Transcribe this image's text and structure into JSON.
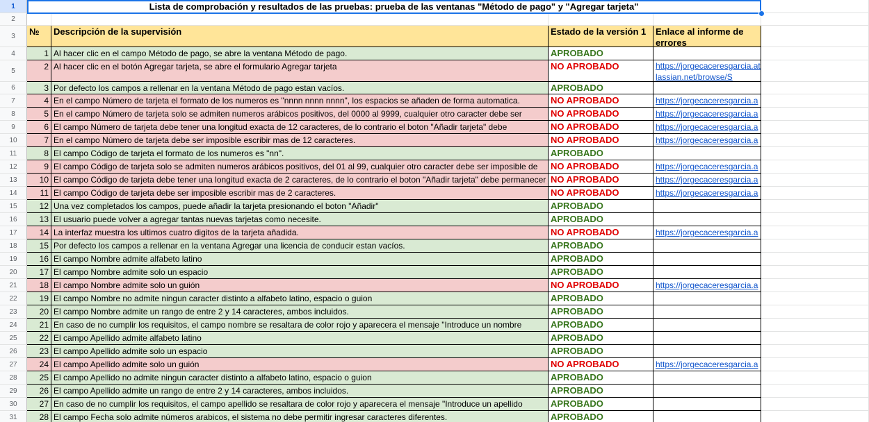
{
  "sheet": {
    "title": "Lista de comprobación y resultados de las pruebas: prueba de las ventanas \"Método de pago\" y \"Agregar tarjeta\"",
    "headers": {
      "num": "№",
      "description": "Descripción de la supervisión",
      "status": "Estado de la versión 1",
      "link": "Enlace al informe de errores"
    },
    "row_numbers": [
      "1",
      "2",
      "3",
      "4",
      "5",
      "6",
      "7",
      "8",
      "9",
      "10",
      "11",
      "12",
      "13",
      "14",
      "15",
      "16",
      "17",
      "18",
      "19",
      "20",
      "21",
      "22",
      "23",
      "24",
      "25",
      "26",
      "27",
      "28",
      "29",
      "30",
      "31"
    ],
    "status_labels": {
      "pass": "APROBADO",
      "fail": "NO APROBADO"
    },
    "colors": {
      "pass_bg": "#d9ead3",
      "fail_bg": "#f4cccc",
      "header_bg": "#ffe599",
      "pass_text": "#38761d",
      "fail_text": "#e00000",
      "link": "#1155cc"
    },
    "rows": [
      {
        "n": "1",
        "desc": "Al hacer clic en el campo Método de pago, se abre la ventana Método de pago.",
        "status": "APROBADO",
        "result": "pass",
        "link": ""
      },
      {
        "n": "2",
        "desc": "Al hacer clic en el botón Agregar tarjeta, se abre el formulario Agregar tarjeta",
        "status": "NO APROBADO",
        "result": "fail",
        "link": "https://jorgecaceresgarcia.atlassian.net/browse/S"
      },
      {
        "n": "3",
        "desc": "Por defecto los campos a rellenar en la ventana Método de pago estan vacíos.",
        "status": "APROBADO",
        "result": "pass",
        "link": ""
      },
      {
        "n": "4",
        "desc": "En el campo Número de tarjeta el formato de los numeros es \"nnnn nnnn nnnn\", los espacios se añaden de forma automatica.",
        "status": "NO APROBADO",
        "result": "fail",
        "link": "https://jorgecaceresgarcia.a"
      },
      {
        "n": "5",
        "desc": "En el campo Número de tarjeta solo se admiten numeros arábicos positivos, del 0000 al 9999, cualquier otro caracter debe ser",
        "status": "NO APROBADO",
        "result": "fail",
        "link": "https://jorgecaceresgarcia.a"
      },
      {
        "n": "6",
        "desc": "El campo Número de tarjeta debe tener una longitud exacta de 12 caracteres, de lo contrario el boton \"Añadir tarjeta\" debe",
        "status": "NO APROBADO",
        "result": "fail",
        "link": "https://jorgecaceresgarcia.a"
      },
      {
        "n": "7",
        "desc": "En el campo Número de tarjeta debe ser imposible escribir mas de 12 caracteres.",
        "status": "NO APROBADO",
        "result": "fail",
        "link": "https://jorgecaceresgarcia.a"
      },
      {
        "n": "8",
        "desc": "El campo Código de tarjeta el formato de los numeros es \"nn\".",
        "status": "APROBADO",
        "result": "pass",
        "link": ""
      },
      {
        "n": "9",
        "desc": "El campo Código de tarjeta solo se admiten numeros arábicos positivos, del 01 al 99, cualquier otro caracter debe ser imposible de",
        "status": "NO APROBADO",
        "result": "fail",
        "link": "https://jorgecaceresgarcia.a"
      },
      {
        "n": "10",
        "desc": "El campo Código de tarjeta debe tener una longitud exacta de 2 caracteres, de lo contrario el boton \"Añadir tarjeta\" debe permanecer",
        "status": "NO APROBADO",
        "result": "fail",
        "link": "https://jorgecaceresgarcia.a"
      },
      {
        "n": "11",
        "desc": "El campo Código de tarjeta debe ser imposible escribir mas de 2 caracteres.",
        "status": "NO APROBADO",
        "result": "fail",
        "link": "https://jorgecaceresgarcia.a"
      },
      {
        "n": "12",
        "desc": "Una vez completados los campos, puede añadir la tarjeta presionando el boton \"Añadir\"",
        "status": "APROBADO",
        "result": "pass",
        "link": ""
      },
      {
        "n": "13",
        "desc": "El usuario puede volver a agregar tantas nuevas tarjetas como necesite.",
        "status": "APROBADO",
        "result": "pass",
        "link": ""
      },
      {
        "n": "14",
        "desc": "La interfaz muestra los ultimos cuatro digitos de la tarjeta añadida.",
        "status": "NO APROBADO",
        "result": "fail",
        "link": "https://jorgecaceresgarcia.a"
      },
      {
        "n": "15",
        "desc": "Por defecto los campos a rellenar en la ventana Agregar una licencia de conducir estan vacíos.",
        "status": "APROBADO",
        "result": "pass",
        "link": ""
      },
      {
        "n": "16",
        "desc": "El campo Nombre admite alfabeto latino",
        "status": "APROBADO",
        "result": "pass",
        "link": ""
      },
      {
        "n": "17",
        "desc": "El campo Nombre admite solo un espacio",
        "status": "APROBADO",
        "result": "pass",
        "link": ""
      },
      {
        "n": "18",
        "desc": "El campo Nombre admite solo un guión",
        "status": "NO APROBADO",
        "result": "fail",
        "link": "https://jorgecaceresgarcia.a"
      },
      {
        "n": "19",
        "desc": "El campo Nombre no admite ningun caracter distinto a alfabeto latino, espacio o guion",
        "status": "APROBADO",
        "result": "pass",
        "link": ""
      },
      {
        "n": "20",
        "desc": "El campo Nombre admite un rango de entre 2 y 14 caracteres, ambos incluidos.",
        "status": "APROBADO",
        "result": "pass",
        "link": ""
      },
      {
        "n": "21",
        "desc": "En caso de no cumplir los requisitos, el campo nombre se resaltara de color rojo y aparecera el mensaje \"Introduce un nombre",
        "status": "APROBADO",
        "result": "pass",
        "link": ""
      },
      {
        "n": "22",
        "desc": "El campo Apellido admite alfabeto latino",
        "status": "APROBADO",
        "result": "pass",
        "link": ""
      },
      {
        "n": "23",
        "desc": "El campo Apellido admite solo un espacio",
        "status": "APROBADO",
        "result": "pass",
        "link": ""
      },
      {
        "n": "24",
        "desc": "El campo Apellido admite solo un guión",
        "status": "NO APROBADO",
        "result": "fail",
        "link": "https://jorgecaceresgarcia.a"
      },
      {
        "n": "25",
        "desc": "El campo Apellido no admite ningun caracter distinto a alfabeto latino, espacio o guion",
        "status": "APROBADO",
        "result": "pass",
        "link": ""
      },
      {
        "n": "26",
        "desc": "El campo Apellido admite un rango de entre 2 y 14 caracteres, ambos incluidos.",
        "status": "APROBADO",
        "result": "pass",
        "link": ""
      },
      {
        "n": "27",
        "desc": "En caso de no cumplir los requisitos, el campo apellido se resaltara de color rojo y aparecera el mensaje \"Introduce un apellido",
        "status": "APROBADO",
        "result": "pass",
        "link": ""
      },
      {
        "n": "28",
        "desc": "El campo Fecha solo admite números arabicos, el sistema no debe permitir ingresar caracteres diferentes.",
        "status": "APROBADO",
        "result": "pass",
        "link": ""
      }
    ]
  }
}
